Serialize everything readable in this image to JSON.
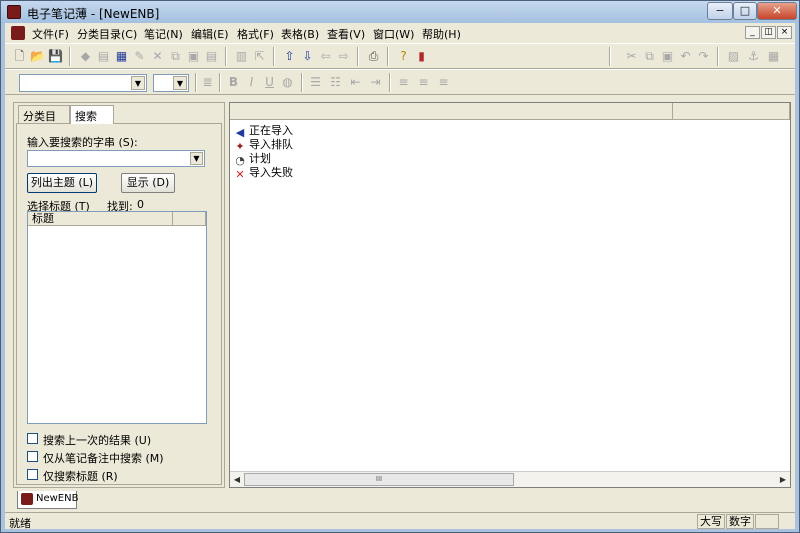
{
  "window": {
    "title": "电子笔记薄 - [NewENB]"
  },
  "menu": [
    "文件(F)",
    "分类目录(C)",
    "笔记(N)",
    "编辑(E)",
    "格式(F)",
    "表格(B)",
    "查看(V)",
    "窗口(W)",
    "帮助(H)"
  ],
  "left_tabs": [
    "分类目录",
    "搜索"
  ],
  "search": {
    "prompt": "输入要搜索的字串 (S):",
    "value": "",
    "list_button": "列出主题 (L)",
    "show_button": "显示 (D)",
    "select_label": "选择标题 (T)",
    "found_label": "找到:",
    "found_count": "0",
    "column_header": "标题",
    "options": [
      "搜索上一次的结果 (U)",
      "仅从笔记备注中搜索 (M)",
      "仅搜索标题 (R)"
    ]
  },
  "right_list": [
    {
      "icon": "import-arrow-icon",
      "label": "正在导入"
    },
    {
      "icon": "queue-icon",
      "label": "导入排队"
    },
    {
      "icon": "plan-icon",
      "label": "计划"
    },
    {
      "icon": "fail-x-icon",
      "label": "导入失败"
    }
  ],
  "scroll_thumb": "III",
  "doc_tab": "NewENB",
  "status": {
    "text": "就绪",
    "caps": "大写",
    "num": "数字"
  },
  "colors": {
    "accent": "#1f3a9a",
    "error": "#c62828",
    "brand": "#7a1b1b"
  }
}
